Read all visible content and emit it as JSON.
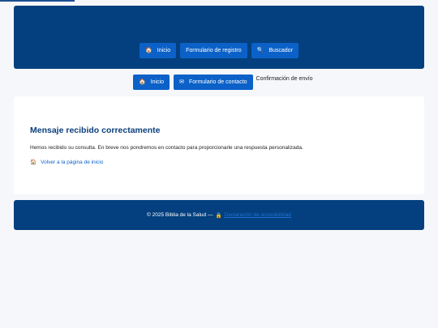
{
  "header": {
    "nav": [
      {
        "icon": "home-icon",
        "glyph": "🏠",
        "label": "Inicio"
      },
      {
        "label": "Formulario de registro"
      },
      {
        "icon": "search-icon",
        "glyph": "🔍",
        "label": "Buscador"
      }
    ]
  },
  "subnav": {
    "items": [
      {
        "icon": "home-icon",
        "glyph": "🏠",
        "label": "Inicio"
      },
      {
        "icon": "envelope-icon",
        "glyph": "✉",
        "label": "Formulario de contacto"
      }
    ],
    "current": "Confirmación de envío"
  },
  "main": {
    "title": "Mensaje recibido correctamente",
    "message": "Hemos recibido su consulta. En breve nos pondremos en contacto para proporcionarle una respuesta personalizada.",
    "back_icon": "🏠",
    "back_label": "Volver a la página de inicio"
  },
  "footer": {
    "copyright": "© 2025 Biblia de la Salud —",
    "lock_icon": "🔒",
    "link_label": "Declaración de accesibilidad"
  },
  "colors": {
    "header_bg": "#04407f",
    "button_bg": "#0b61c8",
    "title": "#0b3f7c",
    "page_bg": "#f5f7fa"
  }
}
